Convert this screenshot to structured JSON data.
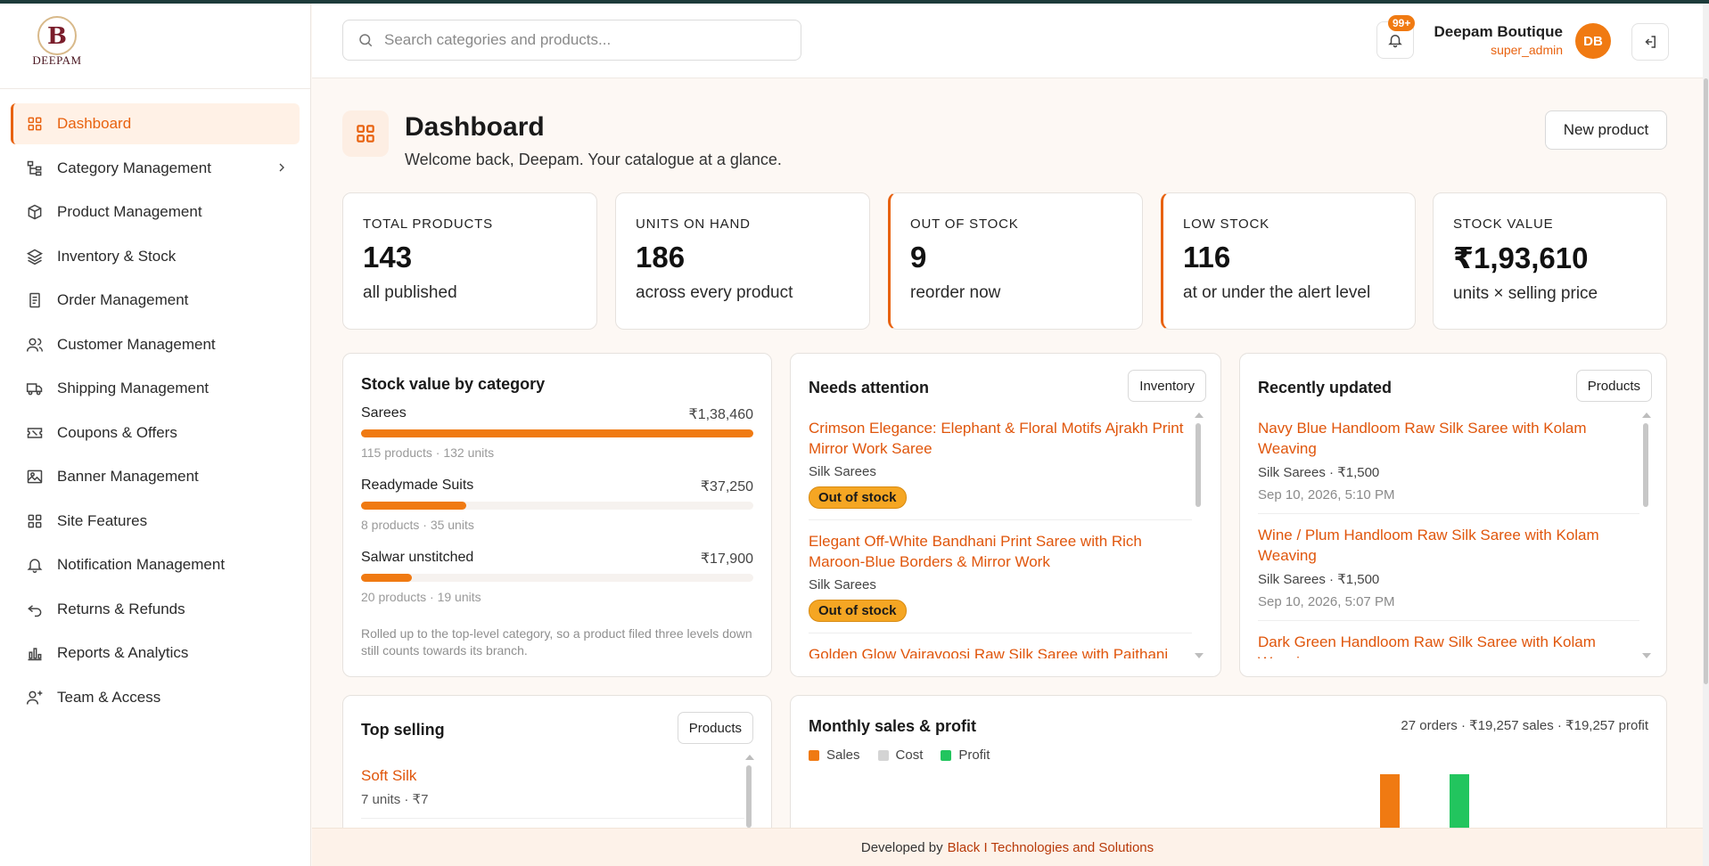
{
  "brand": {
    "logo_text": "DEEPAM",
    "logo_letter": "B"
  },
  "sidebar": {
    "items": [
      {
        "label": "Dashboard",
        "icon": "grid-icon",
        "active": true
      },
      {
        "label": "Category Management",
        "icon": "tree-icon",
        "has_children": true
      },
      {
        "label": "Product Management",
        "icon": "box-icon"
      },
      {
        "label": "Inventory & Stock",
        "icon": "layers-icon"
      },
      {
        "label": "Order Management",
        "icon": "clipboard-icon"
      },
      {
        "label": "Customer Management",
        "icon": "users-icon"
      },
      {
        "label": "Shipping Management",
        "icon": "truck-icon"
      },
      {
        "label": "Coupons & Offers",
        "icon": "ticket-icon"
      },
      {
        "label": "Banner Management",
        "icon": "image-icon"
      },
      {
        "label": "Site Features",
        "icon": "grid-icon"
      },
      {
        "label": "Notification Management",
        "icon": "bell-icon"
      },
      {
        "label": "Returns & Refunds",
        "icon": "undo-icon"
      },
      {
        "label": "Reports & Analytics",
        "icon": "bar-chart-icon"
      },
      {
        "label": "Team & Access",
        "icon": "user-plus-icon"
      }
    ]
  },
  "header": {
    "search_placeholder": "Search categories and products...",
    "notification_count": "99+",
    "user_name": "Deepam Boutique",
    "user_role": "super_admin",
    "avatar_initials": "DB"
  },
  "page": {
    "title": "Dashboard",
    "subtitle": "Welcome back, Deepam. Your catalogue at a glance.",
    "new_product_label": "New product"
  },
  "stats": [
    {
      "label": "TOTAL PRODUCTS",
      "value": "143",
      "sub": "all published",
      "alert": false
    },
    {
      "label": "UNITS ON HAND",
      "value": "186",
      "sub": "across every product",
      "alert": false
    },
    {
      "label": "OUT OF STOCK",
      "value": "9",
      "sub": "reorder now",
      "alert": true
    },
    {
      "label": "LOW STOCK",
      "value": "116",
      "sub": "at or under the alert level",
      "alert": true
    },
    {
      "label": "STOCK VALUE",
      "value": "₹1,93,610",
      "sub": "units × selling price",
      "alert": false
    }
  ],
  "stock_by_category": {
    "title": "Stock value by category",
    "rows": [
      {
        "name": "Sarees",
        "value": "₹1,38,460",
        "amount": 138460,
        "meta": "115 products · 132 units"
      },
      {
        "name": "Readymade Suits",
        "value": "₹37,250",
        "amount": 37250,
        "meta": "8 products · 35 units"
      },
      {
        "name": "Salwar unstitched",
        "value": "₹17,900",
        "amount": 17900,
        "meta": "20 products · 19 units"
      }
    ],
    "note": "Rolled up to the top-level category, so a product filed three levels down still counts towards its branch."
  },
  "needs_attention": {
    "title": "Needs attention",
    "button": "Inventory",
    "items": [
      {
        "title": "Crimson Elegance: Elephant & Floral Motifs Ajrakh Print Mirror Work Saree",
        "category": "Silk Sarees",
        "status": "Out of stock"
      },
      {
        "title": "Elegant Off-White Bandhani Print Saree with Rich Maroon-Blue Borders & Mirror Work",
        "category": "Silk Sarees",
        "status": "Out of stock"
      },
      {
        "title": "Golden Glow Vairavoosi Raw Silk Saree with Paithani",
        "category": "",
        "status": ""
      }
    ]
  },
  "recently_updated": {
    "title": "Recently updated",
    "button": "Products",
    "items": [
      {
        "title": "Navy Blue Handloom Raw Silk Saree with Kolam Weaving",
        "meta": "Silk Sarees · ₹1,500",
        "date": "Sep 10, 2026, 5:10 PM"
      },
      {
        "title": "Wine / Plum Handloom Raw Silk Saree with Kolam Weaving",
        "meta": "Silk Sarees · ₹1,500",
        "date": "Sep 10, 2026, 5:07 PM"
      },
      {
        "title": "Dark Green Handloom Raw Silk Saree with Kolam Weaving",
        "meta": "",
        "date": ""
      }
    ]
  },
  "top_selling": {
    "title": "Top selling",
    "button": "Products",
    "items": [
      {
        "name": "Soft Silk",
        "meta": "7 units · ₹7"
      }
    ]
  },
  "monthly": {
    "title": "Monthly sales & profit",
    "summary": "27 orders · ₹19,257 sales · ₹19,257 profit",
    "legend": [
      {
        "name": "Sales",
        "color": "#f07a12"
      },
      {
        "name": "Cost",
        "color": "#d4d4d4"
      },
      {
        "name": "Profit",
        "color": "#22c55e"
      }
    ]
  },
  "chart_data": {
    "type": "bar",
    "title": "Monthly sales & profit",
    "categories": [
      ""
    ],
    "series": [
      {
        "name": "Sales",
        "values": [
          19257
        ]
      },
      {
        "name": "Cost",
        "values": [
          0
        ]
      },
      {
        "name": "Profit",
        "values": [
          19257
        ]
      }
    ],
    "legend": "top-left",
    "colors": [
      "#f07a12",
      "#d4d4d4",
      "#22c55e"
    ]
  },
  "footer": {
    "prefix": "Developed by",
    "brand": "Black I Technologies and Solutions"
  },
  "colors": {
    "accent": "#f07a12",
    "link": "#e0560c",
    "success": "#22c55e"
  }
}
